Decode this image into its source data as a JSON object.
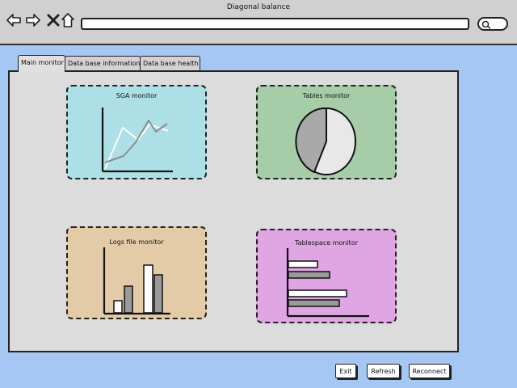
{
  "window": {
    "title": "Diagonal balance"
  },
  "tabs": [
    {
      "label": "Main monitor",
      "active": true
    },
    {
      "label": "Data base information",
      "active": false
    },
    {
      "label": "Data base health",
      "active": false
    }
  ],
  "widgets": {
    "sga": {
      "title": "SGA monitor",
      "color": "#ade0e6"
    },
    "tables": {
      "title": "Tables monitor",
      "color": "#a7cca8"
    },
    "logs": {
      "title": "Logs file monitor",
      "color": "#e3cba8"
    },
    "tablespace": {
      "title": "Tablespace monitor",
      "color": "#e0a5e3"
    }
  },
  "buttons": {
    "exit": "Exit",
    "refresh": "Refresh",
    "reconnect": "Reconnect"
  },
  "icons": [
    "back-arrow-icon",
    "forward-arrow-icon",
    "close-x-icon",
    "home-icon",
    "search-icon"
  ]
}
